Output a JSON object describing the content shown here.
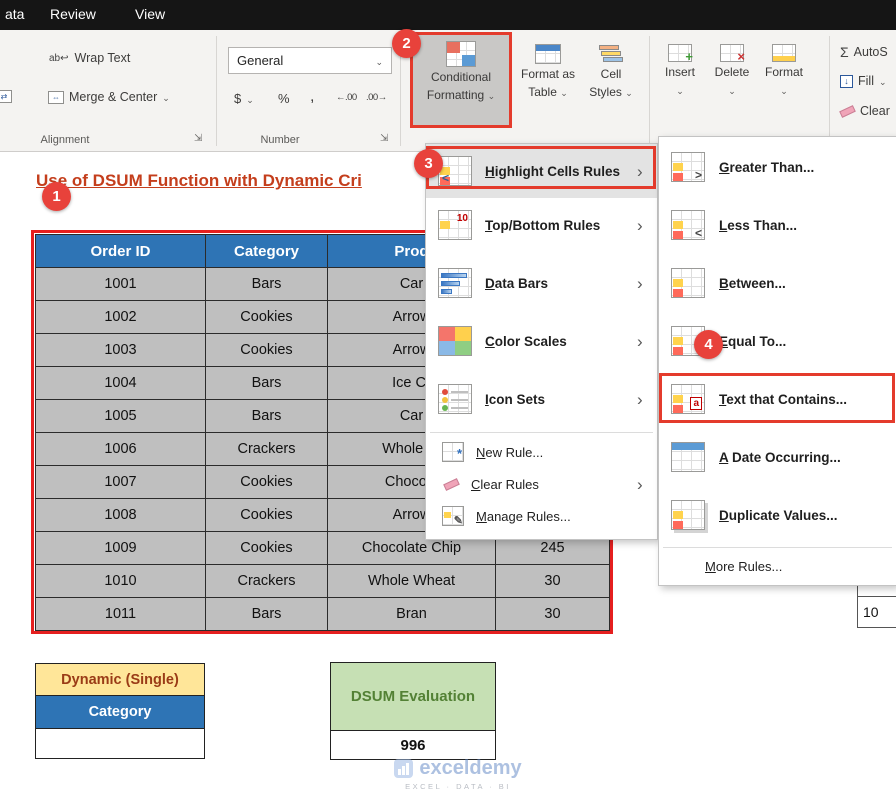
{
  "titlebar": {
    "tabs": [
      {
        "label": "ata"
      },
      {
        "label": "Review"
      },
      {
        "label": "View"
      }
    ]
  },
  "ribbon": {
    "wrap_text_label": "Wrap Text",
    "merge_center_label": "Merge & Center",
    "number_format_value": "General",
    "currency_label": "$",
    "percent_label": "%",
    "comma_label": ",",
    "alignment_group_label": "Alignment",
    "number_group_label": "Number",
    "conditional_formatting_line1": "Conditional",
    "conditional_formatting_line2": "Formatting",
    "format_as_table_line1": "Format as",
    "format_as_table_line2": "Table",
    "cell_styles_line1": "Cell",
    "cell_styles_line2": "Styles",
    "insert_label": "Insert",
    "delete_label": "Delete",
    "format_label": "Format",
    "autosum_icon": "Σ",
    "autosum_label": "AutoS",
    "fill_label": "Fill",
    "clear_label": "Clear"
  },
  "cf_menu": {
    "items": [
      {
        "label": "Highlight Cells Rules",
        "icon_glyph": "<"
      },
      {
        "label": "Top/Bottom Rules",
        "icon_glyph": "10"
      },
      {
        "label": "Data Bars",
        "icon_glyph": ""
      },
      {
        "label": "Color Scales",
        "icon_glyph": ""
      },
      {
        "label": "Icon Sets",
        "icon_glyph": ""
      }
    ],
    "new_rule": "New Rule...",
    "clear_rules": "Clear Rules",
    "manage_rules": "Manage Rules..."
  },
  "hcr_submenu": {
    "items": [
      {
        "label": "Greater Than...",
        "glyph": ">"
      },
      {
        "label": "Less Than...",
        "glyph": "<"
      },
      {
        "label": "Between...",
        "glyph": ""
      },
      {
        "label": "Equal To...",
        "glyph": "="
      },
      {
        "label": "Text that Contains...",
        "glyph": "a"
      },
      {
        "label": "A Date Occurring...",
        "glyph": ""
      },
      {
        "label": "Duplicate Values...",
        "glyph": ""
      }
    ],
    "more_rules": "More Rules..."
  },
  "annotations": {
    "badge1": "1",
    "badge2": "2",
    "badge3": "3",
    "badge4": "4"
  },
  "sheet": {
    "title": "Use of DSUM Function with Dynamic Cri",
    "main_table": {
      "headers": [
        "Order ID",
        "Category",
        "Prod"
      ],
      "rows": [
        {
          "order_id": "1001",
          "category": "Bars",
          "product": "Car",
          "col4": ""
        },
        {
          "order_id": "1002",
          "category": "Cookies",
          "product": "Arrow",
          "col4": ""
        },
        {
          "order_id": "1003",
          "category": "Cookies",
          "product": "Arrow",
          "col4": ""
        },
        {
          "order_id": "1004",
          "category": "Bars",
          "product": "Ice Cr",
          "col4": ""
        },
        {
          "order_id": "1005",
          "category": "Bars",
          "product": "Car",
          "col4": ""
        },
        {
          "order_id": "1006",
          "category": "Crackers",
          "product": "Whole W",
          "col4": ""
        },
        {
          "order_id": "1007",
          "category": "Cookies",
          "product": "Chocola",
          "col4": ""
        },
        {
          "order_id": "1008",
          "category": "Cookies",
          "product": "Arrow",
          "col4": ""
        },
        {
          "order_id": "1009",
          "category": "Cookies",
          "product": "Chocolate Chip",
          "col4": "245"
        },
        {
          "order_id": "1010",
          "category": "Crackers",
          "product": "Whole Wheat",
          "col4": "30"
        },
        {
          "order_id": "1011",
          "category": "Bars",
          "product": "Bran",
          "col4": "30"
        }
      ]
    },
    "criteria_table": {
      "title": "Dynamic (Single)",
      "field": "Category",
      "value": ""
    },
    "dsum_block": {
      "label": "DSUM Evaluation",
      "value": "996"
    },
    "edge_cell_value": "10"
  },
  "watermark": {
    "brand": "exceldemy",
    "tagline": "EXCEL · DATA · BI"
  },
  "colors": {
    "annotation_red": "#E43B2C",
    "table_header_blue": "#2E74B5",
    "table_cell_gray": "#BFBFBF",
    "criteria_yellow": "#FFE699",
    "dsum_green_bg": "#C6E0B4",
    "dsum_green_text": "#538135",
    "title_color": "#C43E1C"
  }
}
